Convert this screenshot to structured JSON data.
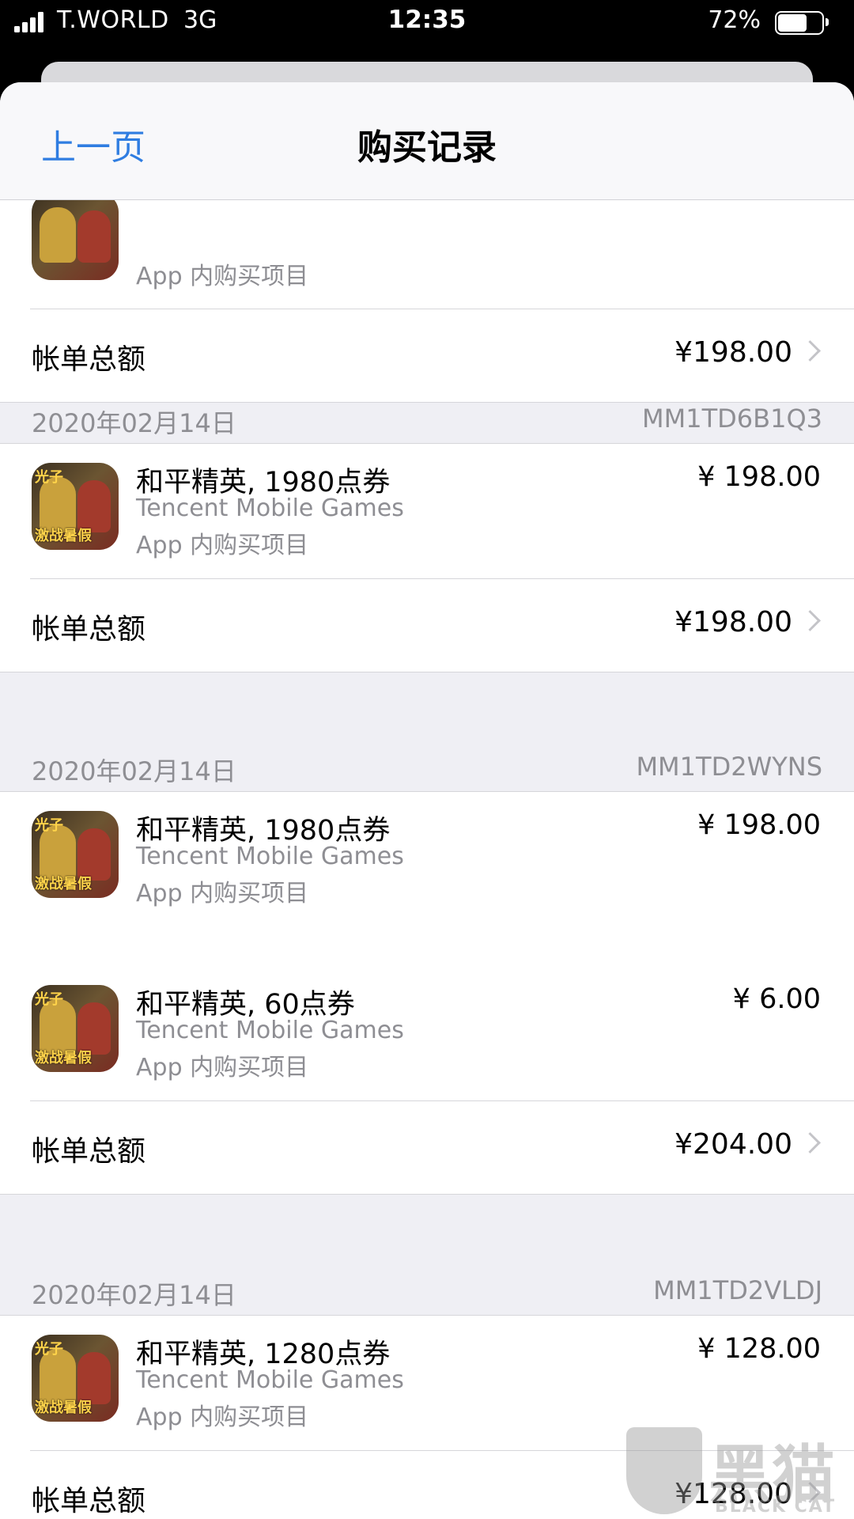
{
  "status_bar": {
    "carrier": "T.WORLD",
    "network": "3G",
    "time": "12:35",
    "battery_percent": "72%",
    "battery_level": 0.72
  },
  "nav": {
    "back_label": "上一页",
    "title": "购买记录"
  },
  "partial_top": {
    "type": "App 内购买项目",
    "total_label": "帐单总额",
    "total": "¥198.00"
  },
  "orders": [
    {
      "date": "2020年02月14日",
      "order_id": "MM1TD6B1Q3",
      "items": [
        {
          "name": "和平精英, 1980点券",
          "developer": "Tencent Mobile Games",
          "type": "App 内购买项目",
          "price": "¥ 198.00",
          "icon_tag": "光子",
          "icon_badge": "激战暑假"
        }
      ],
      "total_label": "帐单总额",
      "total": "¥198.00"
    },
    {
      "date": "2020年02月14日",
      "order_id": "MM1TD2WYNS",
      "items": [
        {
          "name": "和平精英, 1980点券",
          "developer": "Tencent Mobile Games",
          "type": "App 内购买项目",
          "price": "¥ 198.00",
          "icon_tag": "光子",
          "icon_badge": "激战暑假"
        },
        {
          "name": "和平精英, 60点券",
          "developer": "Tencent Mobile Games",
          "type": "App 内购买项目",
          "price": "¥ 6.00",
          "icon_tag": "光子",
          "icon_badge": "激战暑假"
        }
      ],
      "total_label": "帐单总额",
      "total": "¥204.00"
    },
    {
      "date": "2020年02月14日",
      "order_id": "MM1TD2VLDJ",
      "items": [
        {
          "name": "和平精英, 1280点券",
          "developer": "Tencent Mobile Games",
          "type": "App 内购买项目",
          "price": "¥ 128.00",
          "icon_tag": "光子",
          "icon_badge": "激战暑假"
        }
      ],
      "total_label": "帐单总额",
      "total": "¥128.00"
    }
  ],
  "watermark": {
    "cn": "黑猫",
    "en": "BLACK CAT"
  }
}
